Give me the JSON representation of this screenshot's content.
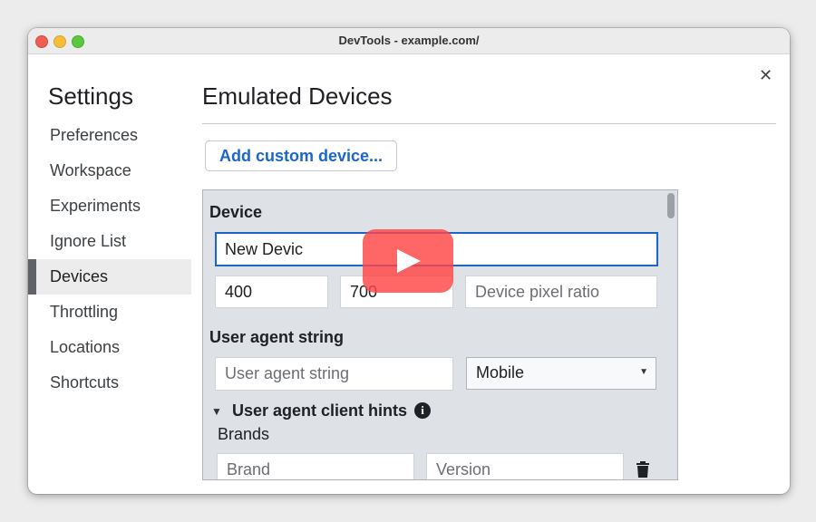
{
  "window": {
    "title": "DevTools - example.com/"
  },
  "settings": {
    "title": "Settings",
    "nav": [
      {
        "label": "Preferences"
      },
      {
        "label": "Workspace"
      },
      {
        "label": "Experiments"
      },
      {
        "label": "Ignore List"
      },
      {
        "label": "Devices",
        "active": true
      },
      {
        "label": "Throttling"
      },
      {
        "label": "Locations"
      },
      {
        "label": "Shortcuts"
      }
    ]
  },
  "main": {
    "title": "Emulated Devices",
    "add_button": "Add custom device...",
    "editor": {
      "device_label": "Device",
      "device_name_value": "New Devic",
      "width_value": "400",
      "height_value": "700",
      "dpr_placeholder": "Device pixel ratio",
      "ua_label": "User agent string",
      "ua_placeholder": "User agent string",
      "ua_type_selected": "Mobile",
      "hints_label": "User agent client hints",
      "brands_label": "Brands",
      "brand_placeholder": "Brand",
      "version_placeholder": "Version"
    }
  },
  "icons": {
    "close": "close-icon",
    "info": "info-icon",
    "trash": "trash-icon",
    "play": "play-icon",
    "expand": "triangle-down-icon",
    "select_caret": "caret-down-icon"
  },
  "colors": {
    "accent_blue": "#1a66c9",
    "play_overlay": "#ff4444",
    "editor_bg": "#dee1e6"
  }
}
